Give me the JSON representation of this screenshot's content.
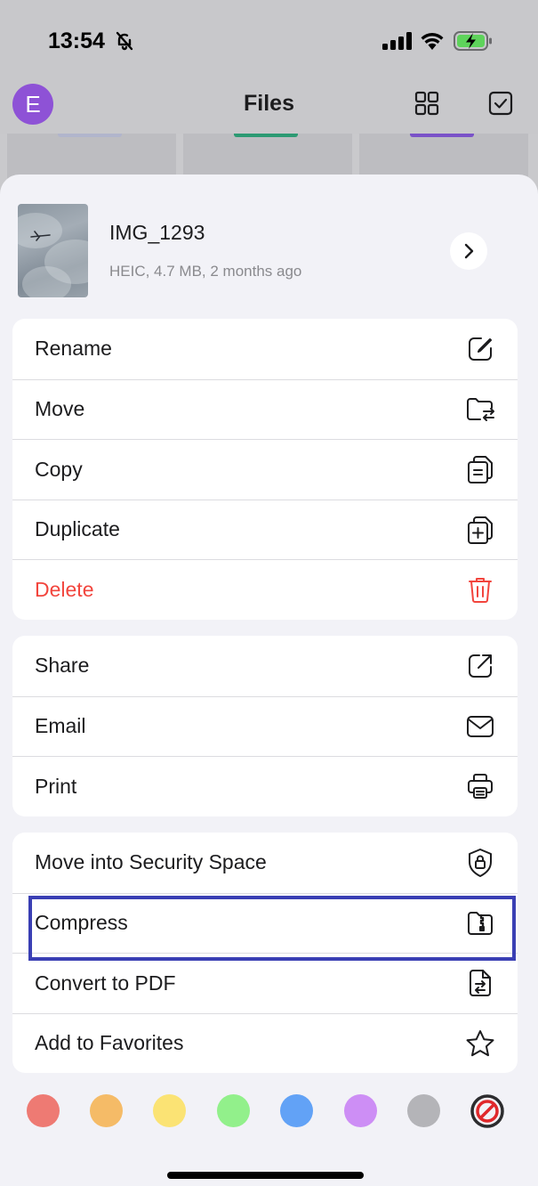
{
  "status_bar": {
    "time": "13:54",
    "icons": [
      "bell-slash-icon",
      "signal-icon",
      "wifi-icon",
      "battery-charging-icon"
    ]
  },
  "nav": {
    "avatar_letter": "E",
    "title": "Files",
    "icons": [
      "grid-icon",
      "select-checkbox-icon"
    ]
  },
  "file": {
    "name": "IMG_1293",
    "meta": "HEIC, 4.7 MB, 2 months ago"
  },
  "groups": [
    {
      "items": [
        {
          "label": "Rename",
          "icon": "edit-icon"
        },
        {
          "label": "Move",
          "icon": "folder-move-icon"
        },
        {
          "label": "Copy",
          "icon": "copy-icon"
        },
        {
          "label": "Duplicate",
          "icon": "duplicate-icon"
        },
        {
          "label": "Delete",
          "icon": "trash-icon",
          "danger": true
        }
      ]
    },
    {
      "items": [
        {
          "label": "Share",
          "icon": "share-icon"
        },
        {
          "label": "Email",
          "icon": "mail-icon"
        },
        {
          "label": "Print",
          "icon": "printer-icon"
        }
      ]
    },
    {
      "items": [
        {
          "label": "Move into Security Space",
          "icon": "shield-lock-icon"
        },
        {
          "label": "Compress",
          "icon": "zip-folder-icon"
        },
        {
          "label": "Convert to PDF",
          "icon": "convert-doc-icon"
        },
        {
          "label": "Add to Favorites",
          "icon": "star-icon"
        }
      ]
    }
  ],
  "tag_colors": [
    "#ee7a73",
    "#f5bb67",
    "#fbe374",
    "#92f08b",
    "#62a2f6",
    "#cd8ef5",
    "#b4b4b8"
  ],
  "tag_clear_icon": "no-tag-icon",
  "colors": {
    "accent_purple": "#8e52d6",
    "danger": "#f2453d",
    "highlight": "#3a3fb4"
  }
}
